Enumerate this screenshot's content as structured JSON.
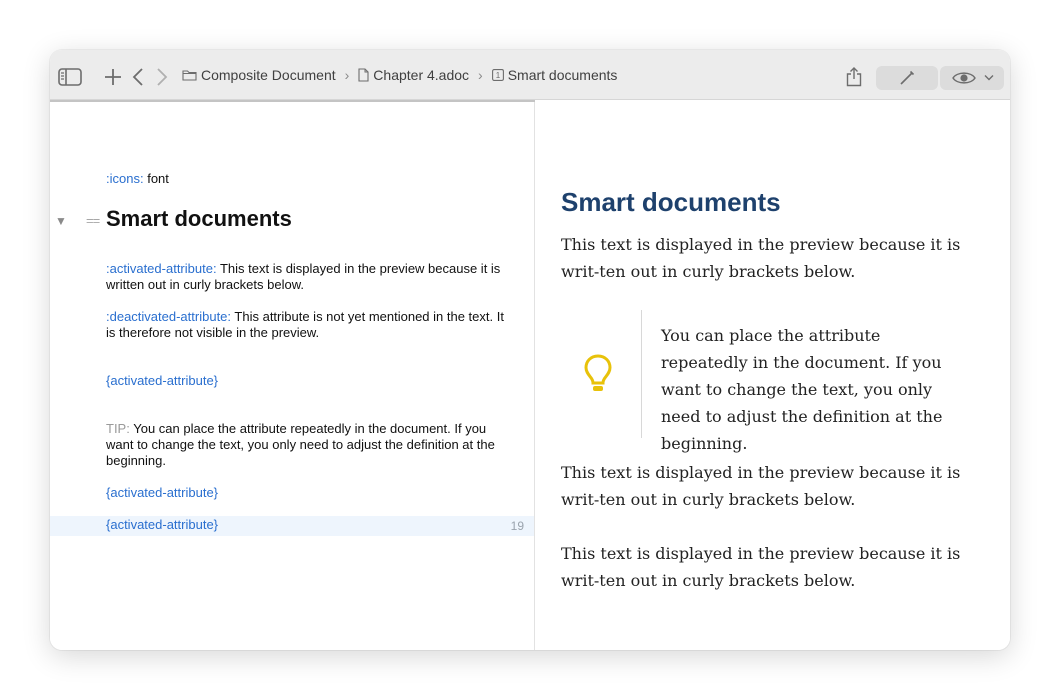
{
  "toolbar": {
    "breadcrumb": [
      {
        "label": "Composite Document",
        "icon": "folder-icon"
      },
      {
        "label": "Chapter 4.adoc",
        "icon": "document-icon"
      },
      {
        "label": "Smart documents",
        "icon": "section-number-icon",
        "badge": "1"
      }
    ]
  },
  "editor": {
    "line_icons": {
      "attr": ":icons:",
      "value": "font"
    },
    "heading_marker": "==",
    "heading": "Smart documents",
    "line_activated": {
      "attr": ":activated-attribute:",
      "value": "This text is displayed in the preview because it is written out in curly brackets below."
    },
    "line_deactivated": {
      "attr": ":deactivated-attribute:",
      "value": "This attribute is not yet mentioned in the text. It is therefore not visible in the preview."
    },
    "ref1": "{activated-attribute}",
    "tip": {
      "label": "TIP:",
      "text": "You can place the attribute repeatedly in the document. If you want to change the text, you only need to adjust the definition at the beginning."
    },
    "ref2": "{activated-attribute}",
    "ref3": "{activated-attribute}",
    "current_line_number": "19"
  },
  "preview": {
    "title": "Smart documents",
    "para1": "This text is displayed in the preview because it is writ-ten out in curly brackets below.",
    "tip_text": "You can place the attribute repeatedly in the document. If you want to change the text, you only need to adjust the definition at the beginning.",
    "para2": "This text is displayed in the preview because it is writ-ten out in curly brackets below.",
    "para3": "This text is displayed in the preview because it is writ-ten out in curly brackets below.",
    "tip_icon": "lightbulb-icon",
    "colors": {
      "title": "#1e416d",
      "tip_icon": "#e8c20a",
      "attribute": "#2a6fcf"
    }
  }
}
